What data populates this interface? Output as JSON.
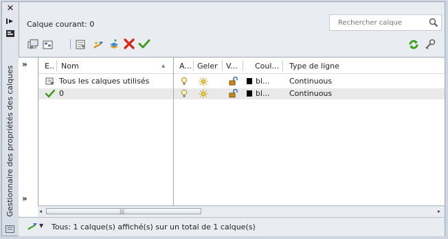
{
  "sidebar": {
    "close_glyph": "✕",
    "title": "Gestionnaire des propriétés des calques"
  },
  "header": {
    "current_layer_label": "Calque courant: 0",
    "search_placeholder": "Rechercher calque"
  },
  "toolbar": {
    "icons": [
      "new-layer-state-icon",
      "layer-states-manager-icon",
      "new-layer-filter-icon",
      "new-group-filter-icon",
      "new-layer-icon",
      "new-layer-vp-frozen-icon",
      "delete-layer-icon",
      "set-current-icon",
      "refresh-icon",
      "settings-icon"
    ]
  },
  "filter_tree": {
    "collapse_label": "»",
    "columns": {
      "status": "E..",
      "name": "Nom",
      "sort": "▲"
    },
    "items": [
      {
        "name": "Tous les calques utilisés",
        "icon": "filter-icon"
      },
      {
        "name": "0",
        "icon": "current-check-icon"
      }
    ]
  },
  "layer_table": {
    "columns": [
      "A...",
      "Geler",
      "V...",
      "Coul...",
      "Type de ligne"
    ],
    "rows": [
      {
        "on": "lightbulb-icon",
        "freeze": "sun-icon",
        "lock": "unlocked-icon",
        "color_swatch": "#000000",
        "color": "bl...",
        "linetype": "Continuous"
      },
      {
        "on": "lightbulb-icon",
        "freeze": "sun-icon",
        "lock": "unlocked-icon",
        "color_swatch": "#000000",
        "color": "bl...",
        "linetype": "Continuous"
      }
    ]
  },
  "scrollbar": {
    "left": "◂",
    "right": "▸",
    "grip": "|||"
  },
  "status": {
    "text": "Tous: 1 calque(s) affiché(s) sur un total de 1 calque(s)"
  },
  "colors": {
    "accent_green": "#3f9c1e",
    "delete_red": "#d42a1a"
  }
}
